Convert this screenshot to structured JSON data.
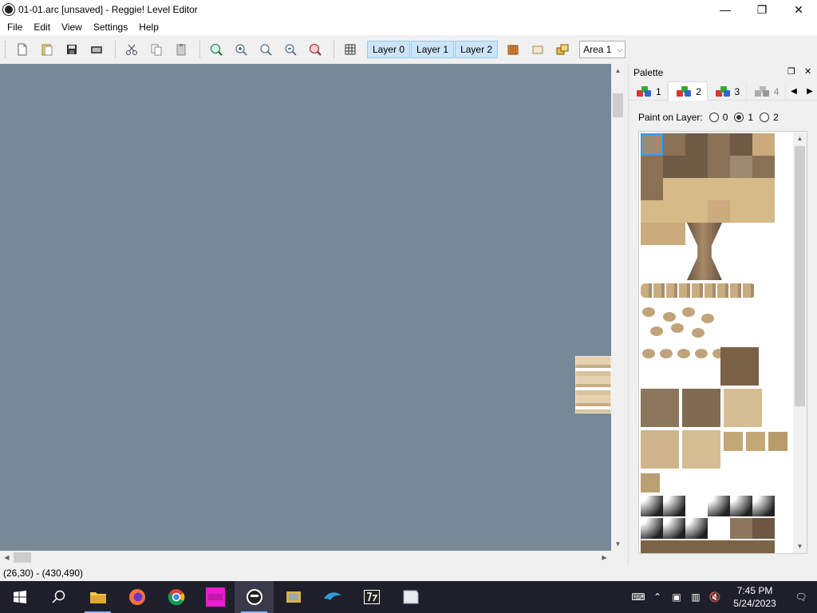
{
  "window": {
    "title": "01-01.arc [unsaved] - Reggie! Level Editor",
    "minimize": "—",
    "maximize": "❐",
    "close": "✕"
  },
  "menu": {
    "file": "File",
    "edit": "Edit",
    "view": "View",
    "settings": "Settings",
    "help": "Help"
  },
  "toolbar": {
    "layer0": "Layer 0",
    "layer1": "Layer 1",
    "layer2": "Layer 2",
    "area_value": "Area 1"
  },
  "palette": {
    "title": "Palette",
    "tabs": [
      "1",
      "2",
      "3",
      "4"
    ],
    "active_tab": "2",
    "paint_label": "Paint on Layer:",
    "layer_options": [
      "0",
      "1",
      "2"
    ],
    "selected_layer": "1"
  },
  "status": {
    "coords": "(26,30) - (430,490)"
  },
  "taskbar": {
    "time": "7:45 PM",
    "date": "5/24/2023"
  },
  "colors": {
    "canvas": "#778899",
    "accent": "#cce4f7",
    "taskbar": "#1f1f2b"
  }
}
